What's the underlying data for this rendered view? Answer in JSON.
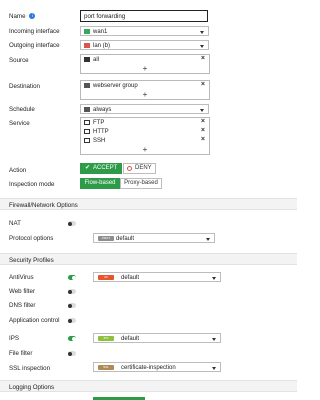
{
  "form": {
    "name": {
      "label": "Name",
      "value": "port forwarding"
    },
    "incoming_interface": {
      "label": "Incoming interface",
      "value": "wan1"
    },
    "outgoing_interface": {
      "label": "Outgoing interface",
      "value": "lan (b)"
    },
    "source": {
      "label": "Source",
      "items": [
        "all"
      ]
    },
    "destination": {
      "label": "Destination",
      "items": [
        "webserver group"
      ]
    },
    "schedule": {
      "label": "Schedule",
      "value": "always"
    },
    "service": {
      "label": "Service",
      "items": [
        "FTP",
        "HTTP",
        "SSH"
      ]
    },
    "action": {
      "label": "Action",
      "accept": "ACCEPT",
      "deny": "DENY"
    },
    "inspection_mode": {
      "label": "Inspection mode",
      "flow": "Flow-based",
      "proxy": "Proxy-based"
    }
  },
  "firewall_network": {
    "title": "Firewall/Network Options",
    "nat": {
      "label": "NAT",
      "enabled": false
    },
    "protocol_options": {
      "label": "Protocol options",
      "badge": "PROT",
      "value": "default"
    }
  },
  "security_profiles": {
    "title": "Security Profiles",
    "antivirus": {
      "label": "AntiVirus",
      "enabled": true,
      "badge": "AV",
      "value": "default"
    },
    "web_filter": {
      "label": "Web filter",
      "enabled": false
    },
    "dns_filter": {
      "label": "DNS filter",
      "enabled": false
    },
    "application_control": {
      "label": "Application control",
      "enabled": false
    },
    "ips": {
      "label": "IPS",
      "enabled": true,
      "badge": "IPS",
      "value": "default"
    },
    "file_filter": {
      "label": "File filter",
      "enabled": false
    },
    "ssl_inspection": {
      "label": "SSL inspection",
      "badge": "SSL",
      "value": "certificate-inspection"
    }
  },
  "logging": {
    "title": "Logging Options"
  },
  "colors": {
    "accent_green": "#2e9b48",
    "av_badge": "#e8542b",
    "ips_badge": "#8fbf3f",
    "prot_badge": "#8e8e8e",
    "ssl_badge": "#b08a55"
  }
}
